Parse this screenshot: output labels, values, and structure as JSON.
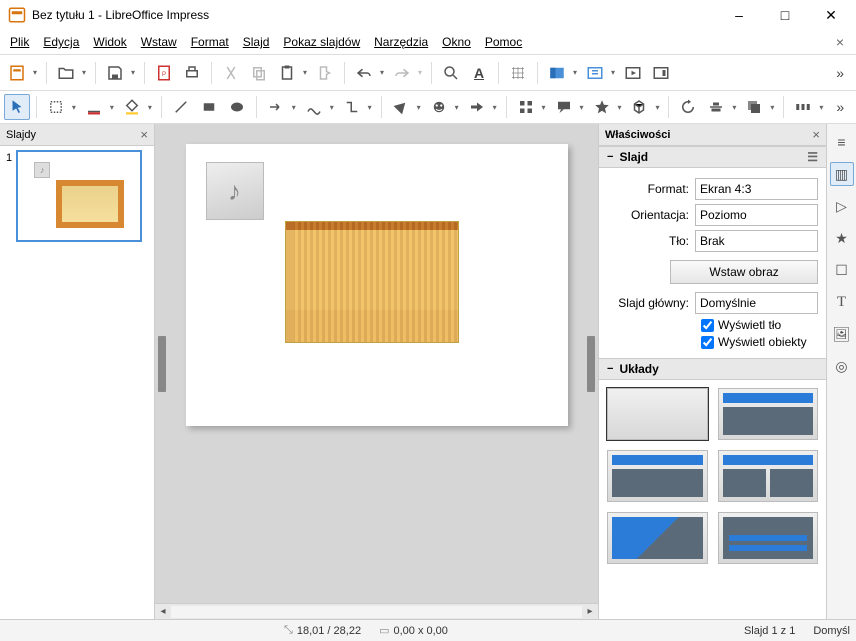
{
  "window": {
    "title": "Bez tytułu 1 - LibreOffice Impress"
  },
  "menu": {
    "file": "Plik",
    "edit": "Edycja",
    "view": "Widok",
    "insert": "Wstaw",
    "format": "Format",
    "slide": "Slajd",
    "slideshow": "Pokaz slajdów",
    "tools": "Narzędzia",
    "window": "Okno",
    "help": "Pomoc"
  },
  "panels": {
    "slides_title": "Slajdy",
    "slide_number": "1",
    "properties_title": "Właściwości"
  },
  "props": {
    "section_slide": "Slajd",
    "format_label": "Format:",
    "format_value": "Ekran 4:3",
    "orientation_label": "Orientacja:",
    "orientation_value": "Poziomo",
    "background_label": "Tło:",
    "background_value": "Brak",
    "insert_image_btn": "Wstaw obraz",
    "master_label": "Slajd główny:",
    "master_value": "Domyślnie",
    "show_bg_label": "Wyświetl tło",
    "show_objects_label": "Wyświetl obiekty",
    "section_layouts": "Układy"
  },
  "status": {
    "pos": "18,01 / 28,22",
    "size": "0,00 x 0,00",
    "slide_info": "Slajd 1 z 1",
    "master": "Domyśl"
  }
}
